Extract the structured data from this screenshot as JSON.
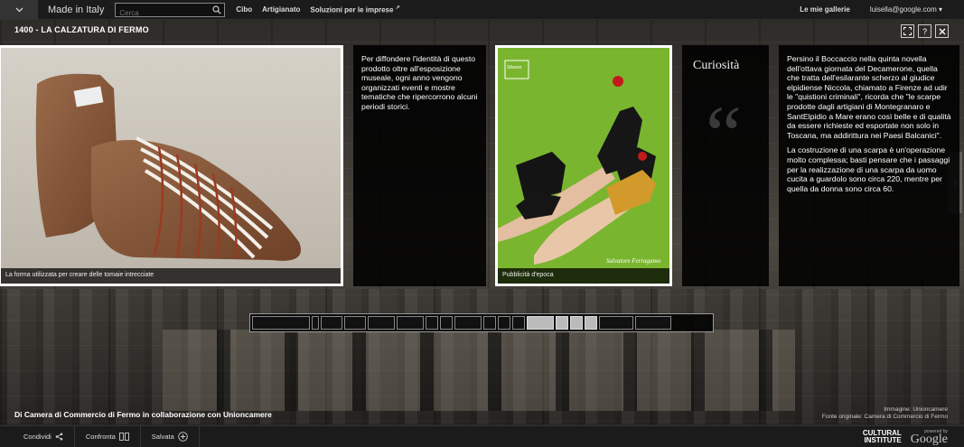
{
  "topbar": {
    "brand": "Made in Italy",
    "search_placeholder": "Cerca",
    "nav": [
      "Cibo",
      "Artigianato",
      "Soluzioni per le imprese"
    ],
    "galleries": "Le mie gallerie",
    "user": "luisella@google.com"
  },
  "page": {
    "title": "1400 - LA CALZATURA DI FERMO"
  },
  "cards": {
    "card1_caption": "La forma utilizzata per creare delle tomaie intrecciate",
    "card2_text": "Per diffondere l'identità di questo prodotto oltre all'esposizione museale, ogni anno vengono organizzati eventi e mostre tematiche che ripercorrono alcuni periodi storici.",
    "card3_caption": "Pubblicità d'epoca",
    "card3_ad_brand": "Silvano",
    "card3_ad_sign": "Salvatore Ferragamo",
    "card4_title": "Curiosità",
    "card5_p1": "Persino il Boccaccio nella quinta novella dell'ottava giornata del Decamerone, quella che tratta dell'esilarante scherzo al giudice elpidiense Niccola, chiamato a Firenze ad udir le \"quistioni criminali\", ricorda che \"le scarpe prodotte dagli artigiani di Montegranaro e SantElpidio a Mare erano così belle e di qualità da essere richieste ed esportate non solo in Toscana, ma addirittura nei Paesi Balcanici\".",
    "card5_p2": "La costruzione di una scarpa è un'operazione molto complessa; basti pensare che i passaggi per la realizzazione di una scarpa da uomo cucita a guardolo sono circa 220, mentre per quella da donna sono circa 60."
  },
  "credits": {
    "left": "Di Camera di Commercio di Fermo in collaborazione con Unioncamere",
    "right_line1": "Immagine: Unioncamere",
    "right_line2": "Fonte originale: Camera di Commercio di Fermo"
  },
  "bottombar": {
    "share": "Condividi",
    "compare": "Confronta",
    "saved": "Salvata",
    "ci_line1": "CULTURAL",
    "ci_line2": "INSTITUTE",
    "powered": "powered by",
    "google": "Google"
  }
}
